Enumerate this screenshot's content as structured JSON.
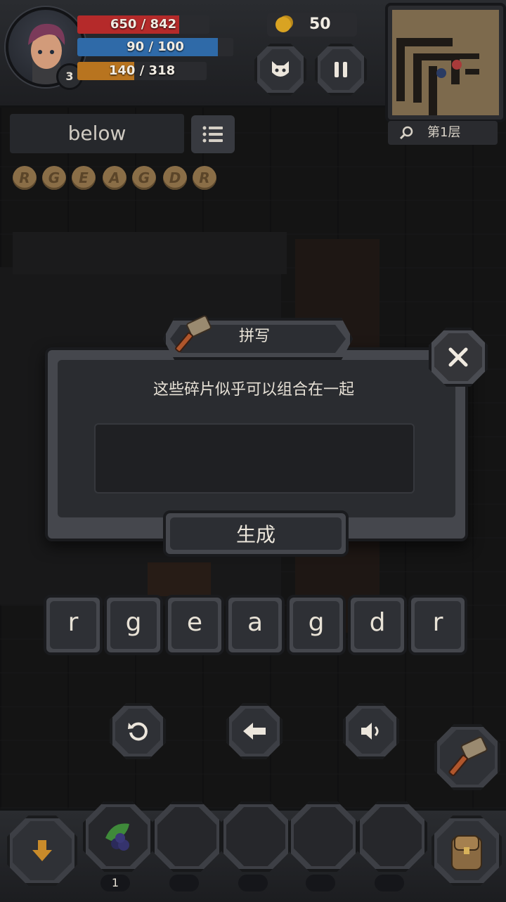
{
  "hud": {
    "hp": {
      "current": 650,
      "max": 842,
      "text": "650 / 842",
      "color": "#b52a2a"
    },
    "mp": {
      "current": 90,
      "max": 100,
      "text": "90 / 100",
      "color": "#2f6aa8"
    },
    "xp": {
      "current": 140,
      "max": 318,
      "text": "140 / 318",
      "color": "#b8741f"
    },
    "level": "3",
    "coins": "50",
    "pet_icon": "cat-face-icon",
    "pause_icon": "pause-icon"
  },
  "minimap": {
    "floor_label": "第1层",
    "search_icon": "magnifier-icon"
  },
  "word_panel": {
    "word": "below",
    "list_icon": "list-icon",
    "fragments": [
      "R",
      "G",
      "E",
      "A",
      "G",
      "D",
      "R"
    ]
  },
  "dialog": {
    "title": "拼写",
    "title_icon": "hammer-icon",
    "message": "这些碎片似乎可以组合在一起",
    "input_value": "",
    "generate_label": "生成",
    "close_icon": "close-icon"
  },
  "letters": [
    "r",
    "g",
    "e",
    "a",
    "g",
    "d",
    "r"
  ],
  "actions": {
    "reset_icon": "refresh-icon",
    "back_icon": "arrow-left-icon",
    "sound_icon": "speaker-icon",
    "craft_icon": "hammer-icon"
  },
  "inventory": {
    "drop_icon": "arrow-down-icon",
    "slots": [
      {
        "item": "berry-icon",
        "count": "1"
      },
      {
        "item": "",
        "count": ""
      },
      {
        "item": "",
        "count": ""
      },
      {
        "item": "",
        "count": ""
      },
      {
        "item": "",
        "count": ""
      }
    ],
    "bag_icon": "backpack-icon"
  }
}
